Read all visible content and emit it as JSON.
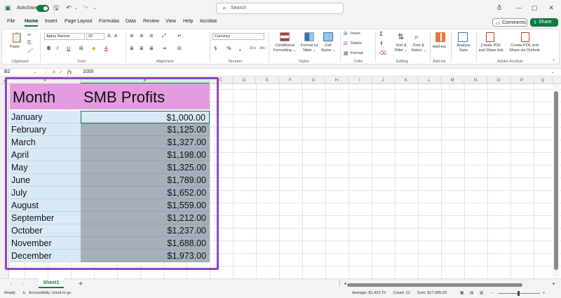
{
  "titlebar": {
    "autosave_label": "AutoSave",
    "search_placeholder": "Search"
  },
  "menu": {
    "tabs": [
      "File",
      "Home",
      "Insert",
      "Page Layout",
      "Formulas",
      "Data",
      "Review",
      "View",
      "Help",
      "Acrobat"
    ],
    "active_tab": "Home",
    "comments_label": "Comments",
    "share_label": "Share"
  },
  "ribbon": {
    "clipboard": {
      "paste_label": "Paste",
      "group_label": "Clipboard"
    },
    "font": {
      "font_name": "Aptos Narrow",
      "font_size": "20",
      "group_label": "Font"
    },
    "alignment": {
      "group_label": "Alignment"
    },
    "number": {
      "format": "Currency",
      "group_label": "Number"
    },
    "styles": {
      "conditional_formatting": [
        "Conditional",
        "Formatting"
      ],
      "format_as_table": [
        "Format as",
        "Table"
      ],
      "cell_styles": [
        "Cell",
        "Styles"
      ],
      "group_label": "Styles"
    },
    "cells": {
      "insert": "Insert",
      "delete": "Delete",
      "format": "Format",
      "group_label": "Cells"
    },
    "editing": {
      "sort_filter": [
        "Sort &",
        "Filter"
      ],
      "find_select": [
        "Find &",
        "Select"
      ],
      "group_label": "Editing"
    },
    "addins": {
      "label": "Add-ins",
      "group_label": "Add-ins"
    },
    "analyse": {
      "label": [
        "Analyse",
        "Data"
      ]
    },
    "acrobat": {
      "create_pdf_share_link": [
        "Create PDF",
        "and Share link"
      ],
      "create_pdf_share_outlook": [
        "Create PDF and",
        "Share via Outlook"
      ],
      "group_label": "Adobe Acrobat"
    }
  },
  "formula_bar": {
    "name_box": "B2",
    "fx_label": "fx",
    "formula": "1000"
  },
  "columns": [
    "A",
    "B",
    "C",
    "D",
    "E",
    "F",
    "G",
    "H",
    "I",
    "J",
    "K",
    "L",
    "M",
    "N",
    "O",
    "P",
    "Q"
  ],
  "active_column": "B",
  "table": {
    "header_month": "Month",
    "header_profit": "SMB Profits",
    "rows": [
      {
        "month": "January",
        "profit": "$1,000.00"
      },
      {
        "month": "February",
        "profit": "$1,125.00"
      },
      {
        "month": "March",
        "profit": "$1,327.00"
      },
      {
        "month": "April",
        "profit": "$1,198.00"
      },
      {
        "month": "May",
        "profit": "$1,325.00"
      },
      {
        "month": "June",
        "profit": "$1,789.00"
      },
      {
        "month": "July",
        "profit": "$1,652.00"
      },
      {
        "month": "August",
        "profit": "$1,559.00"
      },
      {
        "month": "September",
        "profit": "$1,212.00"
      },
      {
        "month": "October",
        "profit": "$1,237.00"
      },
      {
        "month": "November",
        "profit": "$1,688.00"
      },
      {
        "month": "December",
        "profit": "$1,973.00"
      }
    ]
  },
  "sheet_tabs": {
    "active": "Sheet1"
  },
  "status": {
    "ready": "Ready",
    "accessibility": "Accessibility: Good to go",
    "average": "Average: $1,423.75",
    "count": "Count: 12",
    "sum": "Sum: $17,085.00"
  },
  "colors": {
    "excel_green": "#107c41",
    "header_fill": "#e59be0",
    "month_fill": "#d9e9f6",
    "selection_fill": "#a6b0ba",
    "frame": "#8e44c4"
  }
}
